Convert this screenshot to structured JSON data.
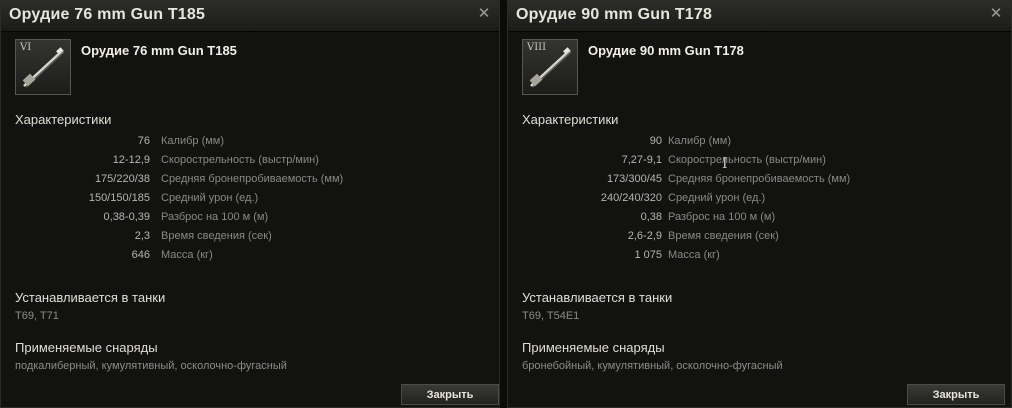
{
  "panels": [
    {
      "window_title": "Орудие 76 mm Gun T185",
      "tier": "VI",
      "gun_name": "Орудие 76 mm Gun T185",
      "stats_title": "Характеристики",
      "stats": [
        {
          "value": "76",
          "label": "Калибр (мм)"
        },
        {
          "value": "12-12,9",
          "label": "Скорострельность (выстр/мин)"
        },
        {
          "value": "175/220/38",
          "label": "Средняя бронепробиваемость (мм)"
        },
        {
          "value": "150/150/185",
          "label": "Средний урон (ед.)"
        },
        {
          "value": "0,38-0,39",
          "label": "Разброс на 100 м (м)"
        },
        {
          "value": "2,3",
          "label": "Время сведения (сек)"
        },
        {
          "value": "646",
          "label": "Масса (кг)"
        }
      ],
      "tanks_title": "Устанавливается в танки",
      "tanks": "T69, T71",
      "shells_title": "Применяемые снаряды",
      "shells": "подкалиберный, кумулятивный, осколочно-фугасный",
      "close_button": "Закрыть"
    },
    {
      "window_title": "Орудие 90 mm Gun T178",
      "tier": "VIII",
      "gun_name": "Орудие 90 mm Gun T178",
      "stats_title": "Характеристики",
      "stats": [
        {
          "value": "90",
          "label": "Калибр (мм)"
        },
        {
          "value": "7,27-9,1",
          "label": "Скорострельность (выстр/мин)"
        },
        {
          "value": "173/300/45",
          "label": "Средняя бронепробиваемость (мм)"
        },
        {
          "value": "240/240/320",
          "label": "Средний урон (ед.)"
        },
        {
          "value": "0,38",
          "label": "Разброс на 100 м (м)"
        },
        {
          "value": "2,6-2,9",
          "label": "Время сведения (сек)"
        },
        {
          "value": "1 075",
          "label": "Масса (кг)"
        }
      ],
      "tanks_title": "Устанавливается в танки",
      "tanks": "T69, T54E1",
      "shells_title": "Применяемые снаряды",
      "shells": "бронебойный, кумулятивный, осколочно-фугасный",
      "close_button": "Закрыть"
    }
  ],
  "icons": {
    "window_close": "close-icon",
    "gun": "gun-icon",
    "cursor": "text-cursor-icon"
  }
}
